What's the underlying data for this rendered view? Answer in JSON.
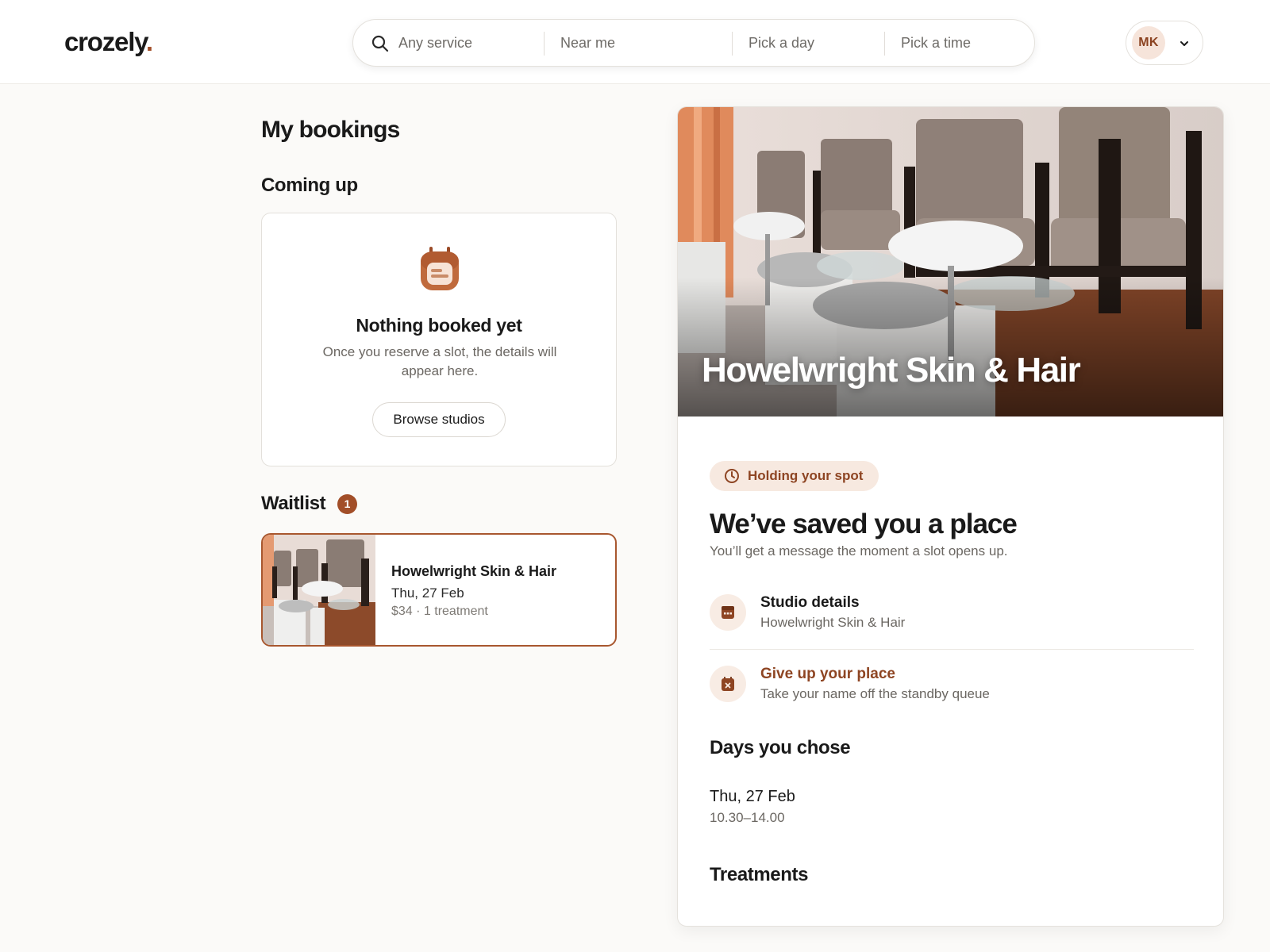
{
  "brand": {
    "name": "crozely",
    "dot": "."
  },
  "search": {
    "service_placeholder": "Any service",
    "location_placeholder": "Near me",
    "day_placeholder": "Pick a day",
    "time_placeholder": "Pick a time"
  },
  "user": {
    "initials": "MK"
  },
  "page": {
    "title": "My bookings"
  },
  "coming_up": {
    "heading": "Coming up",
    "empty_title": "Nothing booked yet",
    "empty_text": "Once you reserve a slot, the details will appear here.",
    "browse_label": "Browse studios"
  },
  "waitlist": {
    "heading": "Waitlist",
    "count": "1",
    "items": [
      {
        "name": "Howelwright Skin & Hair",
        "date": "Thu, 27 Feb",
        "meta": "$34 · 1 treatment"
      }
    ]
  },
  "detail": {
    "studio_name": "Howelwright Skin & Hair",
    "status": "Holding your spot",
    "title": "We’ve saved you a place",
    "subtitle": "You’ll get a message the moment a slot opens up.",
    "actions": [
      {
        "title": "Studio details",
        "subtitle": "Howelwright Skin & Hair",
        "icon": "storefront-icon"
      },
      {
        "title": "Give up your place",
        "subtitle": "Take your name off the standby queue",
        "icon": "calendar-x-icon"
      }
    ],
    "days_heading": "Days you chose",
    "days": [
      {
        "date": "Thu, 27 Feb",
        "time": "10.30–14.00"
      }
    ],
    "treatments_heading": "Treatments"
  },
  "colors": {
    "accent": "#a24e28",
    "accent_light": "#f7e9e0",
    "background": "#fbfaf8",
    "text": "#1a1a1a",
    "muted": "#6b6762"
  }
}
